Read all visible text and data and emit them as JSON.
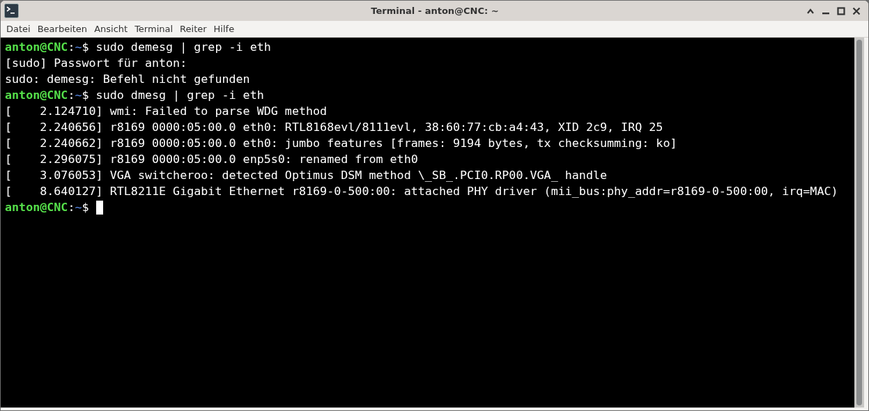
{
  "window": {
    "title": "Terminal - anton@CNC: ~"
  },
  "menu": [
    "Datei",
    "Bearbeiten",
    "Ansicht",
    "Terminal",
    "Reiter",
    "Hilfe"
  ],
  "terminal": {
    "lines": [
      {
        "kind": "prompt",
        "user_host": "anton@CNC",
        "separator": ":",
        "path": "~",
        "symbol": "$",
        "command": "sudo demesg | grep -i eth"
      },
      {
        "kind": "output",
        "text": "[sudo] Passwort für anton:"
      },
      {
        "kind": "output",
        "text": "sudo: demesg: Befehl nicht gefunden"
      },
      {
        "kind": "prompt",
        "user_host": "anton@CNC",
        "separator": ":",
        "path": "~",
        "symbol": "$",
        "command": "sudo dmesg | grep -i eth"
      },
      {
        "kind": "output",
        "text": "[    2.124710] wmi: Failed to parse WDG method"
      },
      {
        "kind": "output",
        "text": "[    2.240656] r8169 0000:05:00.0 eth0: RTL8168evl/8111evl, 38:60:77:cb:a4:43, XID 2c9, IRQ 25"
      },
      {
        "kind": "output",
        "text": "[    2.240662] r8169 0000:05:00.0 eth0: jumbo features [frames: 9194 bytes, tx checksumming: ko]"
      },
      {
        "kind": "output",
        "text": "[    2.296075] r8169 0000:05:00.0 enp5s0: renamed from eth0"
      },
      {
        "kind": "output",
        "text": "[    3.076053] VGA switcheroo: detected Optimus DSM method \\_SB_.PCI0.RP00.VGA_ handle"
      },
      {
        "kind": "output",
        "text": "[    8.640127] RTL8211E Gigabit Ethernet r8169-0-500:00: attached PHY driver (mii_bus:phy_addr=r8169-0-500:00, irq=MAC)"
      },
      {
        "kind": "prompt",
        "user_host": "anton@CNC",
        "separator": ":",
        "path": "~",
        "symbol": "$",
        "cursor": true
      }
    ]
  }
}
